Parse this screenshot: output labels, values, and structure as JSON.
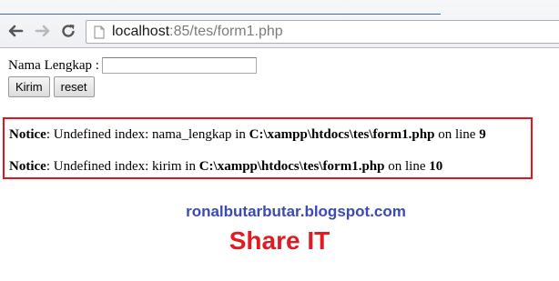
{
  "browser": {
    "url_host": "localhost",
    "url_rest": ":85/tes/form1.php"
  },
  "form": {
    "label": "Nama Lengkap :",
    "input_value": "",
    "submit_label": "Kirim",
    "reset_label": "reset"
  },
  "notices": [
    {
      "kind": "Notice",
      "message": ": Undefined index: nama_lengkap in ",
      "path": "C:\\xampp\\htdocs\\tes\\form1.php",
      "on_line": " on line ",
      "line": "9"
    },
    {
      "kind": "Notice",
      "message": ": Undefined index: kirim in ",
      "path": "C:\\xampp\\htdocs\\tes\\form1.php",
      "on_line": " on line ",
      "line": "10"
    }
  ],
  "watermark": {
    "blog": "ronalbutarbutar.blogspot.com",
    "tagline": "Share IT",
    "blog_color": "#3b4bb5",
    "tagline_color": "#e21b22"
  },
  "colors": {
    "notice_border": "#e2151d"
  }
}
